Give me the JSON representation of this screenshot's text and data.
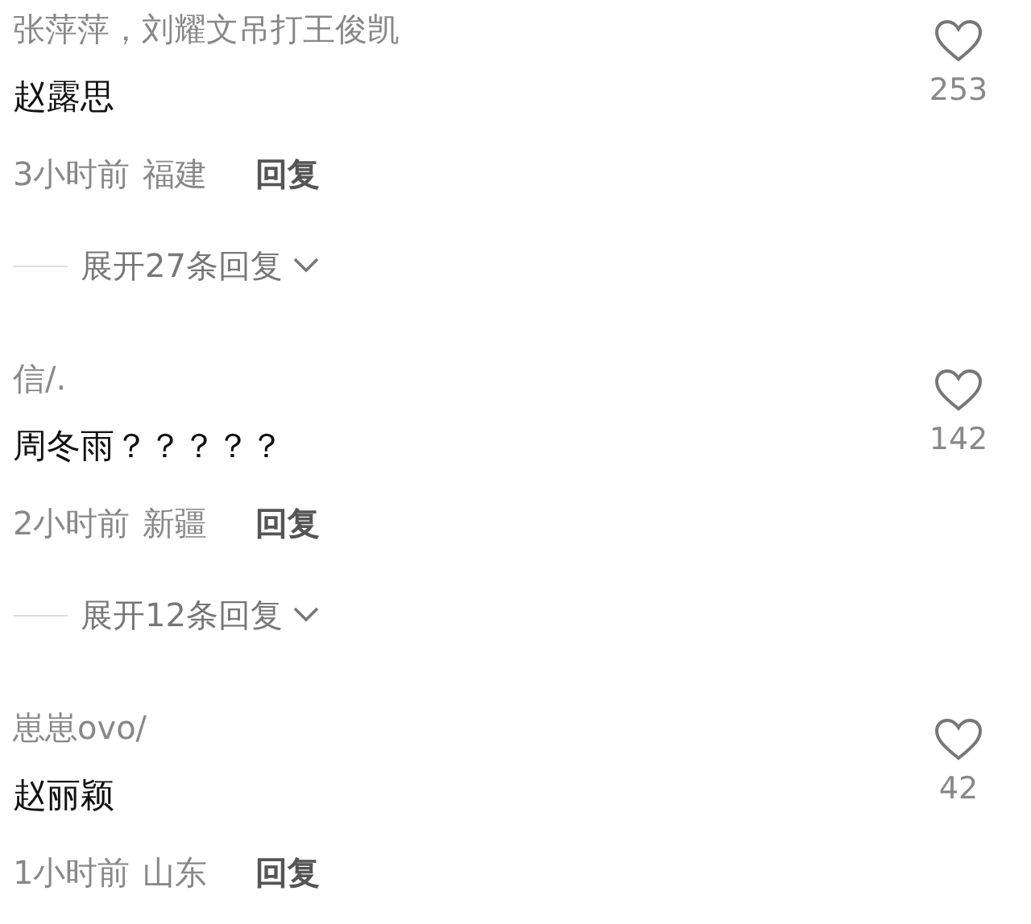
{
  "comments": [
    {
      "username": "张萍萍，刘耀文吊打王俊凯",
      "text": "赵露思",
      "time": "3小时前",
      "location": "福建",
      "reply_label": "回复",
      "likes": "253",
      "expand_replies": "展开27条回复"
    },
    {
      "username": "信/.",
      "text": "周冬雨？？？？？",
      "time": "2小时前",
      "location": "新疆",
      "reply_label": "回复",
      "likes": "142",
      "expand_replies": "展开12条回复"
    },
    {
      "username": "崽崽ovo/",
      "text": "赵丽颖",
      "time": "1小时前",
      "location": "山东",
      "reply_label": "回复",
      "likes": "42"
    }
  ]
}
